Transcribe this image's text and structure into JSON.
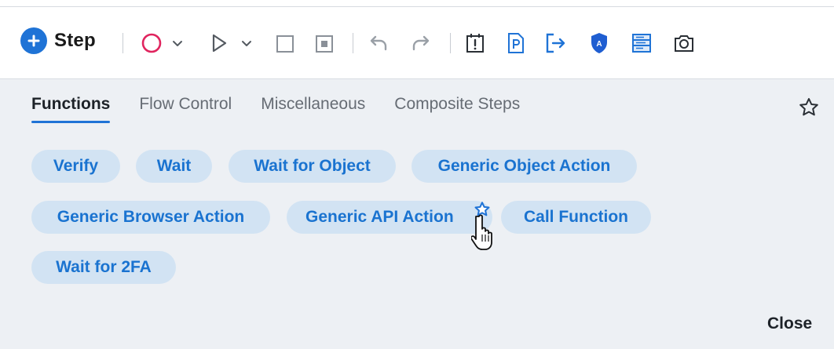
{
  "toolbar": {
    "step_label": "Step",
    "icons": [
      "add-step-icon",
      "record-icon",
      "record-dropdown-icon",
      "play-icon",
      "play-dropdown-icon",
      "stop-icon",
      "pause-icon",
      "undo-icon",
      "redo-icon",
      "clipboard-alert-icon",
      "document-icon",
      "export-icon",
      "shield-icon",
      "list-panel-icon",
      "camera-icon"
    ]
  },
  "tabs": [
    {
      "label": "Functions",
      "active": true
    },
    {
      "label": "Flow Control",
      "active": false
    },
    {
      "label": "Miscellaneous",
      "active": false
    },
    {
      "label": "Composite Steps",
      "active": false
    }
  ],
  "chips": [
    {
      "label": "Verify"
    },
    {
      "label": "Wait"
    },
    {
      "label": "Wait for Object"
    },
    {
      "label": "Generic Object Action"
    },
    {
      "label": "Generic Browser Action"
    },
    {
      "label": "Generic API Action"
    },
    {
      "label": "Call Function"
    },
    {
      "label": "Wait for 2FA"
    }
  ],
  "close_label": "Close",
  "colors": {
    "accent": "#1f73d6",
    "record_red": "#e0245e",
    "chip_bg": "#d2e3f3",
    "chip_text": "#1a73d0",
    "panel_bg": "#edf0f4"
  }
}
